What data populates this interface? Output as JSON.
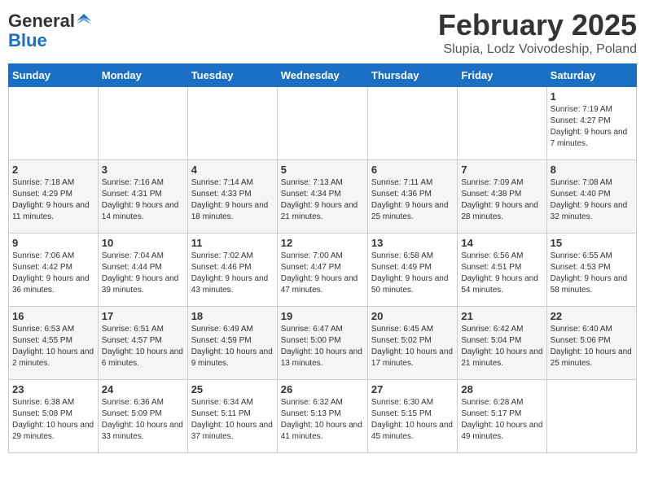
{
  "header": {
    "logo_line1": "General",
    "logo_line2": "Blue",
    "month_title": "February 2025",
    "subtitle": "Slupia, Lodz Voivodeship, Poland"
  },
  "weekdays": [
    "Sunday",
    "Monday",
    "Tuesday",
    "Wednesday",
    "Thursday",
    "Friday",
    "Saturday"
  ],
  "weeks": [
    [
      {
        "day": "",
        "info": ""
      },
      {
        "day": "",
        "info": ""
      },
      {
        "day": "",
        "info": ""
      },
      {
        "day": "",
        "info": ""
      },
      {
        "day": "",
        "info": ""
      },
      {
        "day": "",
        "info": ""
      },
      {
        "day": "1",
        "info": "Sunrise: 7:19 AM\nSunset: 4:27 PM\nDaylight: 9 hours and 7 minutes."
      }
    ],
    [
      {
        "day": "2",
        "info": "Sunrise: 7:18 AM\nSunset: 4:29 PM\nDaylight: 9 hours and 11 minutes."
      },
      {
        "day": "3",
        "info": "Sunrise: 7:16 AM\nSunset: 4:31 PM\nDaylight: 9 hours and 14 minutes."
      },
      {
        "day": "4",
        "info": "Sunrise: 7:14 AM\nSunset: 4:33 PM\nDaylight: 9 hours and 18 minutes."
      },
      {
        "day": "5",
        "info": "Sunrise: 7:13 AM\nSunset: 4:34 PM\nDaylight: 9 hours and 21 minutes."
      },
      {
        "day": "6",
        "info": "Sunrise: 7:11 AM\nSunset: 4:36 PM\nDaylight: 9 hours and 25 minutes."
      },
      {
        "day": "7",
        "info": "Sunrise: 7:09 AM\nSunset: 4:38 PM\nDaylight: 9 hours and 28 minutes."
      },
      {
        "day": "8",
        "info": "Sunrise: 7:08 AM\nSunset: 4:40 PM\nDaylight: 9 hours and 32 minutes."
      }
    ],
    [
      {
        "day": "9",
        "info": "Sunrise: 7:06 AM\nSunset: 4:42 PM\nDaylight: 9 hours and 36 minutes."
      },
      {
        "day": "10",
        "info": "Sunrise: 7:04 AM\nSunset: 4:44 PM\nDaylight: 9 hours and 39 minutes."
      },
      {
        "day": "11",
        "info": "Sunrise: 7:02 AM\nSunset: 4:46 PM\nDaylight: 9 hours and 43 minutes."
      },
      {
        "day": "12",
        "info": "Sunrise: 7:00 AM\nSunset: 4:47 PM\nDaylight: 9 hours and 47 minutes."
      },
      {
        "day": "13",
        "info": "Sunrise: 6:58 AM\nSunset: 4:49 PM\nDaylight: 9 hours and 50 minutes."
      },
      {
        "day": "14",
        "info": "Sunrise: 6:56 AM\nSunset: 4:51 PM\nDaylight: 9 hours and 54 minutes."
      },
      {
        "day": "15",
        "info": "Sunrise: 6:55 AM\nSunset: 4:53 PM\nDaylight: 9 hours and 58 minutes."
      }
    ],
    [
      {
        "day": "16",
        "info": "Sunrise: 6:53 AM\nSunset: 4:55 PM\nDaylight: 10 hours and 2 minutes."
      },
      {
        "day": "17",
        "info": "Sunrise: 6:51 AM\nSunset: 4:57 PM\nDaylight: 10 hours and 6 minutes."
      },
      {
        "day": "18",
        "info": "Sunrise: 6:49 AM\nSunset: 4:59 PM\nDaylight: 10 hours and 9 minutes."
      },
      {
        "day": "19",
        "info": "Sunrise: 6:47 AM\nSunset: 5:00 PM\nDaylight: 10 hours and 13 minutes."
      },
      {
        "day": "20",
        "info": "Sunrise: 6:45 AM\nSunset: 5:02 PM\nDaylight: 10 hours and 17 minutes."
      },
      {
        "day": "21",
        "info": "Sunrise: 6:42 AM\nSunset: 5:04 PM\nDaylight: 10 hours and 21 minutes."
      },
      {
        "day": "22",
        "info": "Sunrise: 6:40 AM\nSunset: 5:06 PM\nDaylight: 10 hours and 25 minutes."
      }
    ],
    [
      {
        "day": "23",
        "info": "Sunrise: 6:38 AM\nSunset: 5:08 PM\nDaylight: 10 hours and 29 minutes."
      },
      {
        "day": "24",
        "info": "Sunrise: 6:36 AM\nSunset: 5:09 PM\nDaylight: 10 hours and 33 minutes."
      },
      {
        "day": "25",
        "info": "Sunrise: 6:34 AM\nSunset: 5:11 PM\nDaylight: 10 hours and 37 minutes."
      },
      {
        "day": "26",
        "info": "Sunrise: 6:32 AM\nSunset: 5:13 PM\nDaylight: 10 hours and 41 minutes."
      },
      {
        "day": "27",
        "info": "Sunrise: 6:30 AM\nSunset: 5:15 PM\nDaylight: 10 hours and 45 minutes."
      },
      {
        "day": "28",
        "info": "Sunrise: 6:28 AM\nSunset: 5:17 PM\nDaylight: 10 hours and 49 minutes."
      },
      {
        "day": "",
        "info": ""
      }
    ]
  ]
}
